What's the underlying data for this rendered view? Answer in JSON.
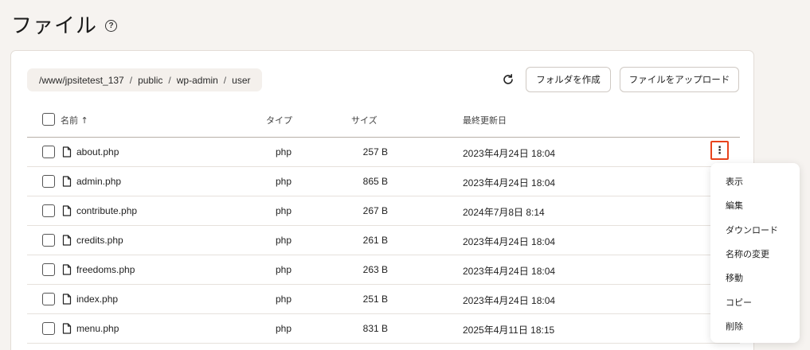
{
  "page": {
    "title": "ファイル"
  },
  "breadcrumb": {
    "segments": [
      "/www/jpsitetest_137",
      "public",
      "wp-admin",
      "user"
    ],
    "separator": "/"
  },
  "toolbar": {
    "create_folder_label": "フォルダを作成",
    "upload_label": "ファイルをアップロード"
  },
  "table": {
    "headers": {
      "name": "名前",
      "sort_indicator": "↑",
      "type": "タイプ",
      "size": "サイズ",
      "modified": "最終更新日"
    },
    "rows": [
      {
        "name": "about.php",
        "type": "php",
        "size": "257 B",
        "modified": "2023年4月24日 18:04"
      },
      {
        "name": "admin.php",
        "type": "php",
        "size": "865 B",
        "modified": "2023年4月24日 18:04"
      },
      {
        "name": "contribute.php",
        "type": "php",
        "size": "267 B",
        "modified": "2024年7月8日 8:14"
      },
      {
        "name": "credits.php",
        "type": "php",
        "size": "261 B",
        "modified": "2023年4月24日 18:04"
      },
      {
        "name": "freedoms.php",
        "type": "php",
        "size": "263 B",
        "modified": "2023年4月24日 18:04"
      },
      {
        "name": "index.php",
        "type": "php",
        "size": "251 B",
        "modified": "2023年4月24日 18:04"
      },
      {
        "name": "menu.php",
        "type": "php",
        "size": "831 B",
        "modified": "2025年4月11日 18:15"
      }
    ]
  },
  "context_menu": {
    "items": [
      "表示",
      "編集",
      "ダウンロード",
      "名称の変更",
      "移動",
      "コピー",
      "削除"
    ]
  },
  "colors": {
    "background": "#f6f3f0",
    "highlight": "#e8431c",
    "breadcrumb_bg": "#f4f0ec"
  },
  "icons": {
    "help": "question-circle-icon",
    "refresh": "refresh-icon",
    "file": "file-icon",
    "more": "kebab-menu-icon"
  }
}
